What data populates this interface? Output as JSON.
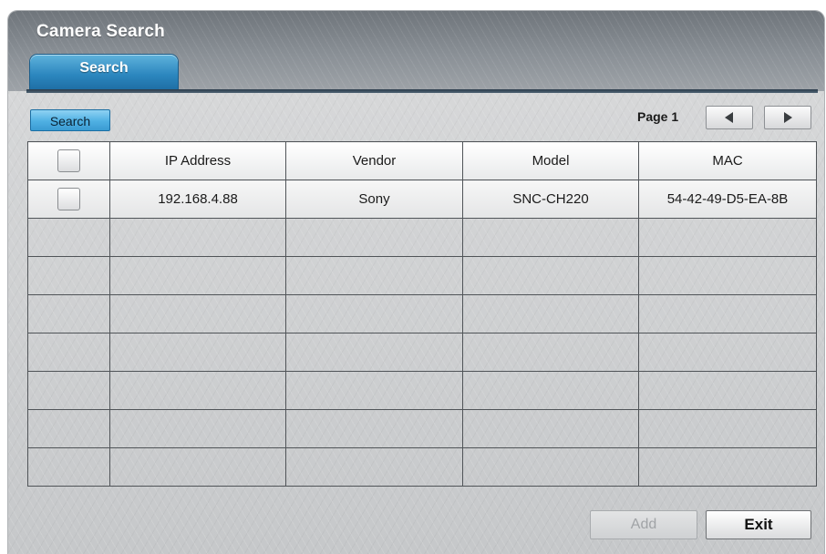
{
  "window": {
    "title": "Camera Search"
  },
  "tabs": [
    {
      "label": "Search",
      "active": true
    }
  ],
  "toolbar": {
    "search_label": "Search",
    "page_label": "Page 1",
    "prev_icon": "triangle-left-icon",
    "next_icon": "triangle-right-icon"
  },
  "table": {
    "columns": [
      "IP Address",
      "Vendor",
      "Model",
      "MAC"
    ],
    "rows": [
      {
        "checked": false,
        "ip": "192.168.4.88",
        "vendor": "Sony",
        "model": "SNC-CH220",
        "mac": "54-42-49-D5-EA-8B"
      }
    ],
    "empty_row_count": 7
  },
  "footer": {
    "add_label": "Add",
    "add_enabled": false,
    "exit_label": "Exit"
  },
  "colors": {
    "accent": "#2b86be",
    "titlebar": "#7c8288",
    "grid_line": "#505458"
  }
}
